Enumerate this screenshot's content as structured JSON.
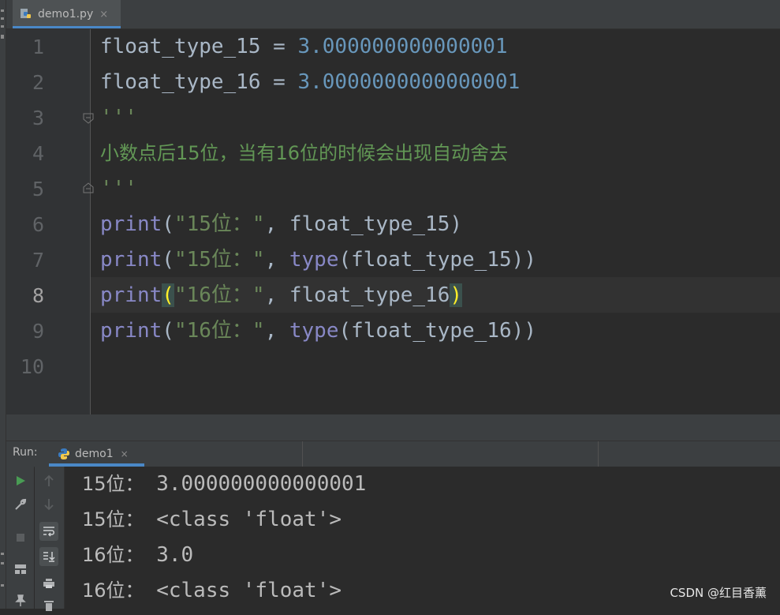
{
  "editor_tab": {
    "label": "demo1.py",
    "close": "×"
  },
  "editor": {
    "line_numbers": [
      "1",
      "2",
      "3",
      "4",
      "5",
      "6",
      "7",
      "8",
      "9",
      "10"
    ],
    "current_line": "8",
    "lines": [
      {
        "var": "float_type_15",
        "op": " = ",
        "num": "3.000000000000001"
      },
      {
        "var": "float_type_16",
        "op": " = ",
        "num": "3.0000000000000001"
      },
      {
        "doc": "'''"
      },
      {
        "comment": "小数点后15位，当有16位的时候会出现自动舍去"
      },
      {
        "doc": "'''"
      },
      {
        "fn": "print",
        "open": "(",
        "str": "\"15位：\"",
        "sep": ", ",
        "arg": "float_type_15",
        "close": ")"
      },
      {
        "fn": "print",
        "open": "(",
        "str": "\"15位：\"",
        "sep": ", ",
        "fn2": "type",
        "arg": "(float_type_15)",
        "close": ")"
      },
      {
        "fn": "print",
        "open": "(",
        "str": "\"16位：\"",
        "sep": ", ",
        "arg": "float_type_16",
        "close": ")"
      },
      {
        "fn": "print",
        "open": "(",
        "str": "\"16位：\"",
        "sep": ", ",
        "fn2": "type",
        "arg": "(float_type_16)",
        "close": ")"
      }
    ]
  },
  "run": {
    "title": "Run:",
    "tab_label": "demo1",
    "close": "×",
    "output": [
      {
        "label": "15位：",
        "value": "3.000000000000001"
      },
      {
        "label": "15位：",
        "value": "<class 'float'>"
      },
      {
        "label": "16位：",
        "value": "3.0"
      },
      {
        "label": "16位：",
        "value": "<class 'float'>"
      }
    ]
  },
  "watermark": "CSDN @红目香薰",
  "colors": {
    "accent": "#4a88c7",
    "number": "#6897bb",
    "string": "#6a8759",
    "keyword": "#8888c6",
    "brace_match": "#ffef28"
  }
}
